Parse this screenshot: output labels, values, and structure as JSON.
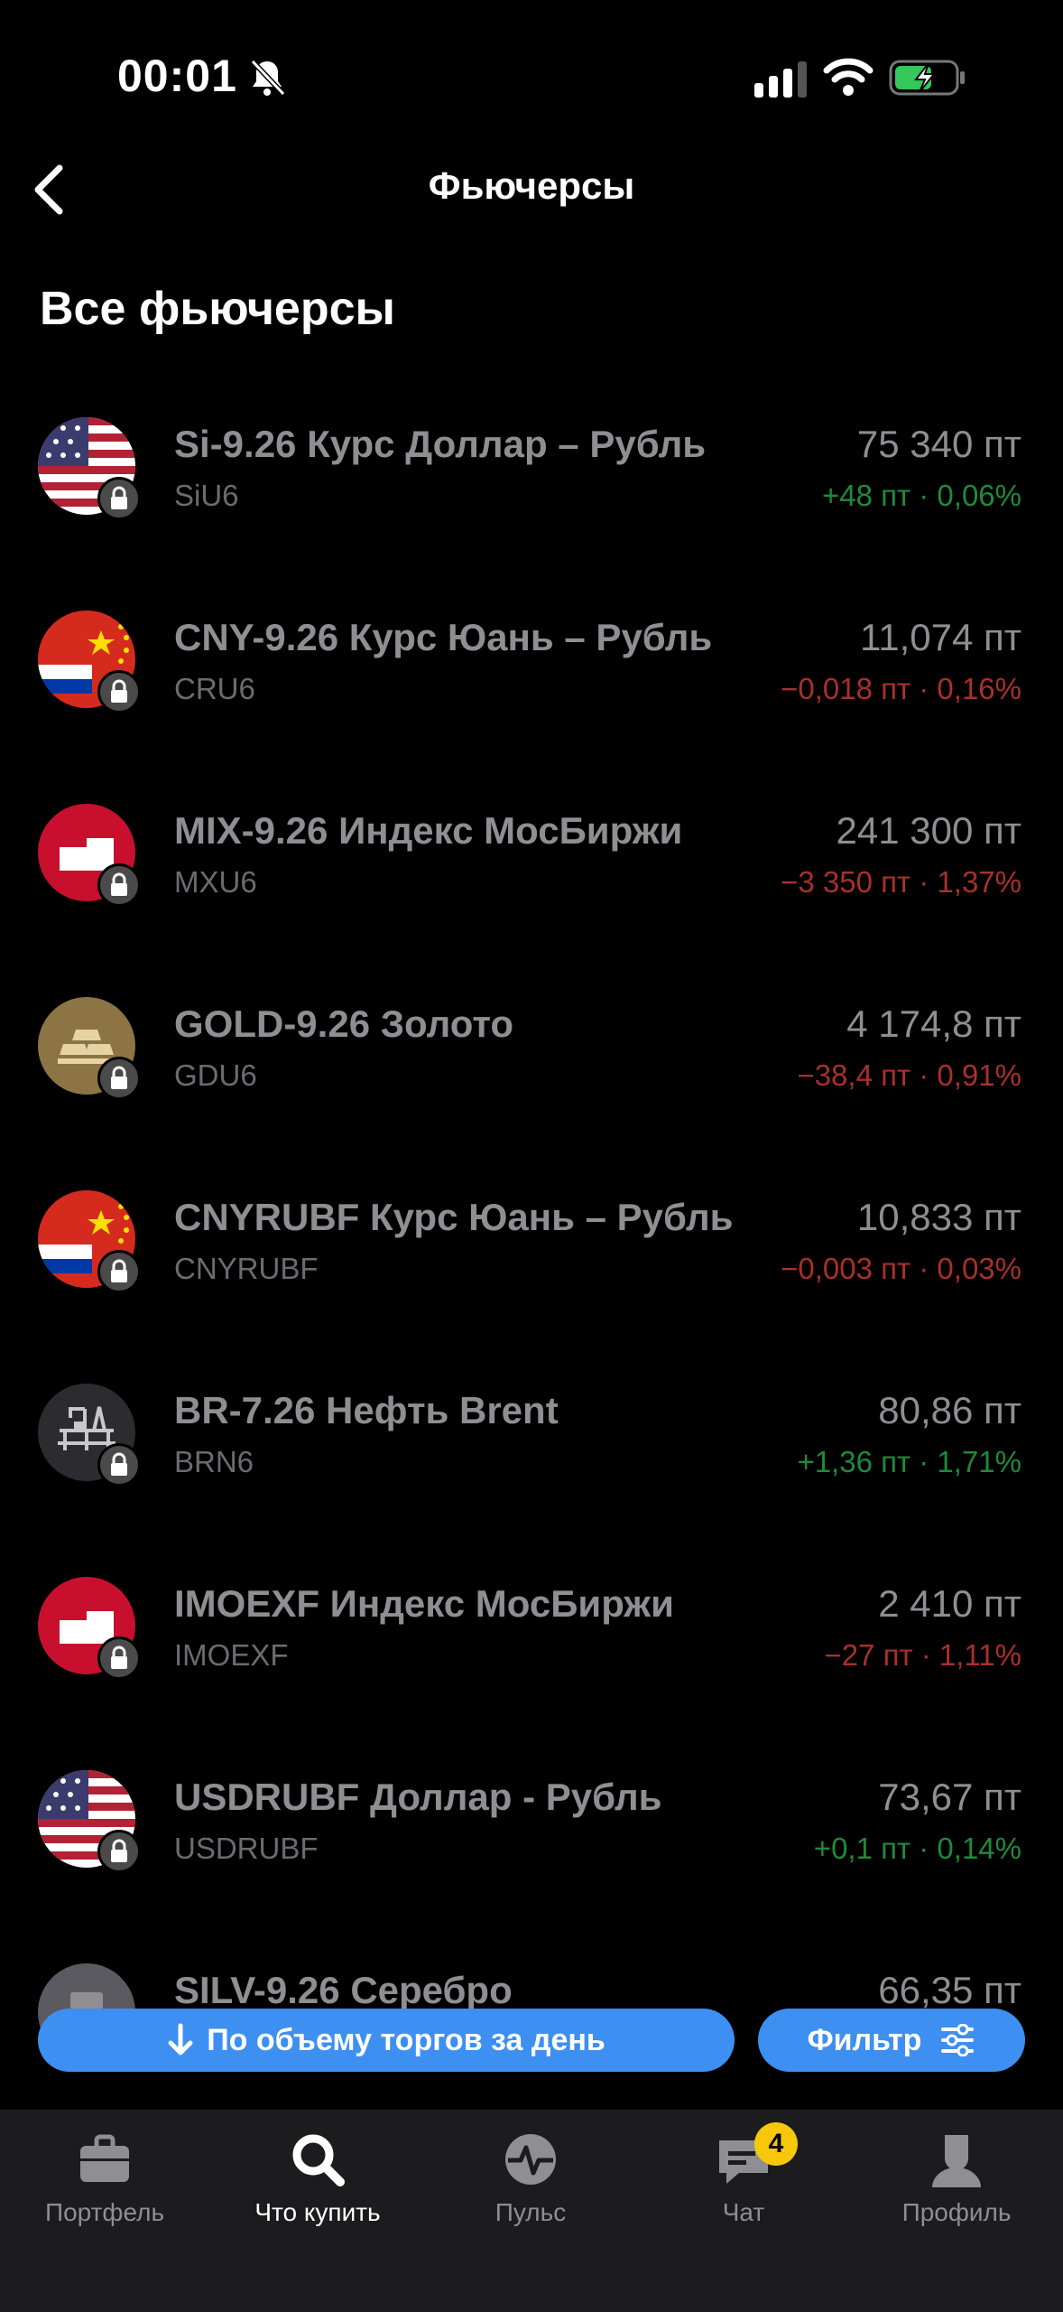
{
  "status_bar": {
    "time": "00:01"
  },
  "header": {
    "title": "Фьючерсы",
    "back_icon": "chevron-left-icon"
  },
  "section": {
    "title": "Все фьючерсы"
  },
  "futures": [
    {
      "name": "Si-9.26 Курс Доллар – Рубль",
      "ticker": "SiU6",
      "price": "75 340 пт",
      "change": "+48 пт · 0,06%",
      "direction": "up",
      "icon": "us-flag-icon"
    },
    {
      "name": "CNY-9.26 Курс Юань – Рубль",
      "ticker": "CRU6",
      "price": "11,074 пт",
      "change": "−0,018 пт · 0,16%",
      "direction": "down",
      "icon": "cn-ru-flag-icon"
    },
    {
      "name": "MIX-9.26 Индекс МосБиржи",
      "ticker": "MXU6",
      "price": "241 300 пт",
      "change": "−3 350 пт · 1,37%",
      "direction": "down",
      "icon": "moex-icon"
    },
    {
      "name": "GOLD-9.26 Золото",
      "ticker": "GDU6",
      "price": "4 174,8 пт",
      "change": "−38,4 пт · 0,91%",
      "direction": "down",
      "icon": "gold-bars-icon"
    },
    {
      "name": "CNYRUBF Курс Юань – Рубль",
      "ticker": "CNYRUBF",
      "price": "10,833 пт",
      "change": "−0,003 пт · 0,03%",
      "direction": "down",
      "icon": "cn-ru-flag-icon"
    },
    {
      "name": "BR-7.26 Нефть Brent",
      "ticker": "BRN6",
      "price": "80,86 пт",
      "change": "+1,36 пт · 1,71%",
      "direction": "up",
      "icon": "oil-rig-icon"
    },
    {
      "name": "IMOEXF Индекс МосБиржи",
      "ticker": "IMOEXF",
      "price": "2 410 пт",
      "change": "−27 пт · 1,11%",
      "direction": "down",
      "icon": "moex-icon"
    },
    {
      "name": "USDRUBF Доллар - Рубль",
      "ticker": "USDRUBF",
      "price": "73,67 пт",
      "change": "+0,1 пт · 0,14%",
      "direction": "up",
      "icon": "us-flag-icon"
    },
    {
      "name": "SILV-9.26 Серебро",
      "ticker": "",
      "price": "66,35 пт",
      "change": "",
      "direction": "up",
      "icon": "silver-bars-icon"
    }
  ],
  "actions": {
    "sort_label": "По объему торгов за день",
    "filter_label": "Фильтр"
  },
  "tab_bar": {
    "tabs": [
      {
        "label": "Портфель",
        "icon": "briefcase-icon"
      },
      {
        "label": "Что купить",
        "icon": "search-icon",
        "active": true
      },
      {
        "label": "Пульс",
        "icon": "pulse-icon"
      },
      {
        "label": "Чат",
        "icon": "chat-icon",
        "badge": "4"
      },
      {
        "label": "Профиль",
        "icon": "profile-icon"
      }
    ]
  },
  "colors": {
    "accent": "#3d8ff2",
    "positive": "#1f8a3a",
    "negative": "#a9302c",
    "badge": "#f7c80a"
  }
}
